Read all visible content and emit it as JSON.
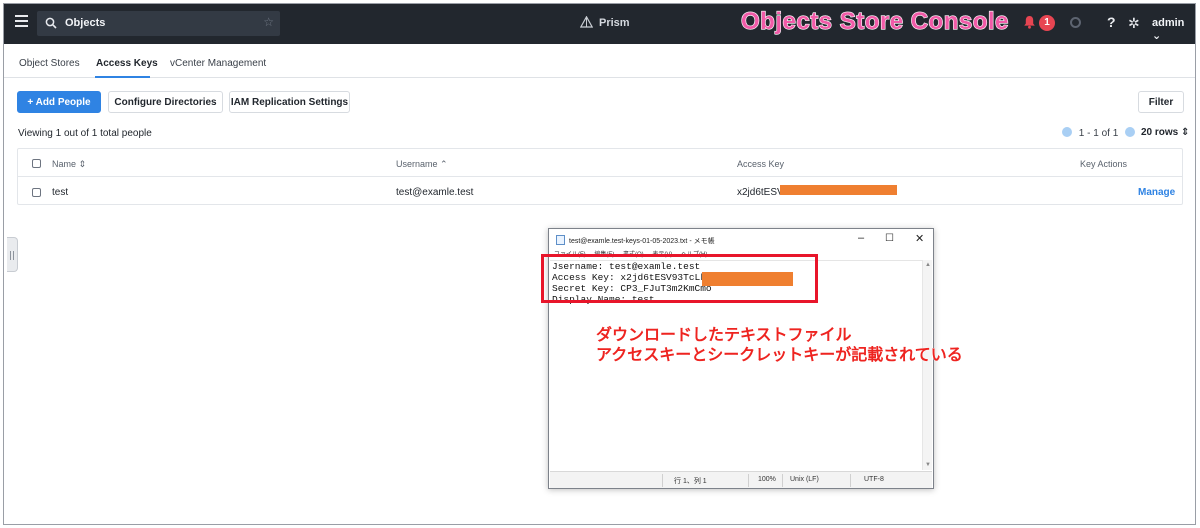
{
  "topbar": {
    "search_value": "Objects",
    "product": "Prism",
    "console_title": "Objects Store Console",
    "alert_count": "1",
    "help_glyph": "?",
    "user": "admin ⌄"
  },
  "tabs": [
    "Object Stores",
    "Access Keys",
    "vCenter Management"
  ],
  "active_tab": "Access Keys",
  "toolbar": {
    "add_people": "+ Add People",
    "configure_directories": "Configure Directories",
    "iam_replication": "IAM Replication Settings",
    "filter": "Filter"
  },
  "viewing_text": "Viewing 1 out of 1 total people",
  "pager": {
    "range": "1 - 1 of 1",
    "rows": "20 rows ⇕"
  },
  "table": {
    "headers": [
      "Name ⇕",
      "Username ⌃",
      "Access Key",
      "Key Actions"
    ],
    "rows": [
      {
        "name": "test",
        "username": "test@examle.test",
        "access_key": "x2jd6tESV93",
        "action": "Manage"
      }
    ]
  },
  "notepad": {
    "title": "test@examle.test-keys-01-05-2023.txt - メモ帳",
    "menu": [
      "ファイル(F)",
      "編集(E)",
      "書式(O)",
      "表示(V)",
      "ヘルプ(H)"
    ],
    "lines": [
      "Jsername: test@examle.test",
      "Access Key: x2jd6tESV93TcLkr",
      "Secret Key: CP3_FJuT3m2KmCmo",
      "Display Name: test"
    ],
    "status": {
      "position": "行 1、列 1",
      "zoom": "100%",
      "eol": "Unix (LF)",
      "encoding": "UTF-8"
    }
  },
  "annotation": {
    "line1": "ダウンロードしたテキストファイル",
    "line2": "アクセスキーとシークレットキーが記載されている"
  },
  "colors": {
    "accent": "#2f83e3",
    "topbar": "#22272e",
    "annotation": "#ee2420",
    "redaction": "#ef7f30"
  }
}
